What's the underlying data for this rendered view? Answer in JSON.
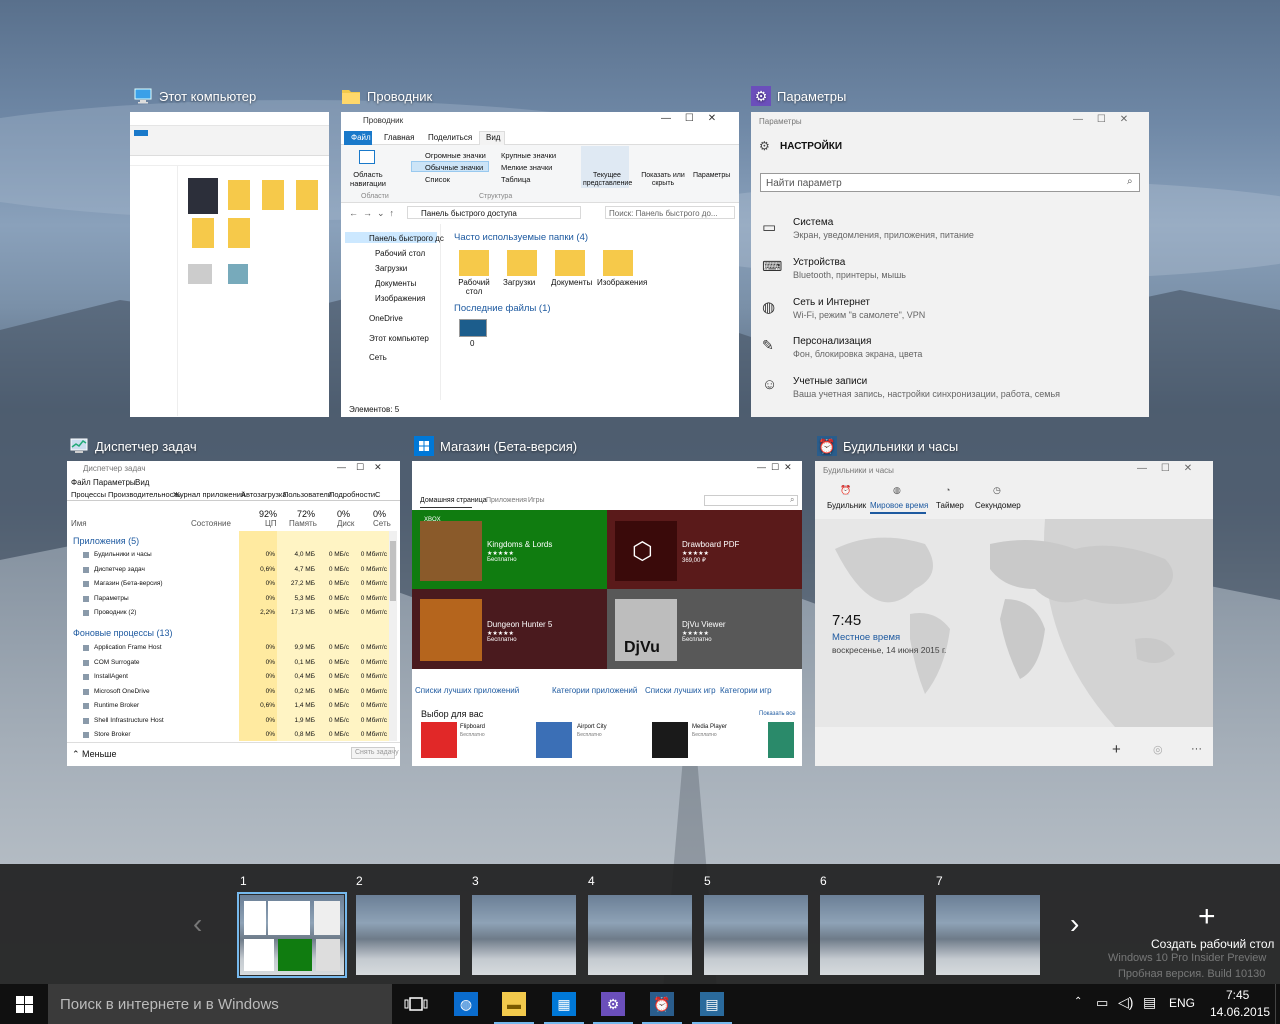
{
  "windows": {
    "this_pc": {
      "title": "Этот компьютер"
    },
    "explorer": {
      "title": "Проводник",
      "window_title": "Проводник",
      "ribbon_tabs": [
        "Файл",
        "Главная",
        "Поделиться",
        "Вид"
      ],
      "ribbon": {
        "nav_pane": "Область навигации",
        "huge": "Огромные значки",
        "large": "Крупные значки",
        "normal": "Обычные значки",
        "small": "Мелкие значки",
        "list": "Список",
        "table": "Таблица",
        "current_view": "Текущее представление",
        "show_hide": "Показать или скрыть",
        "params": "Параметры",
        "group_areas": "Области",
        "group_structure": "Структура"
      },
      "address": "Панель быстрого доступа",
      "search_placeholder": "Поиск: Панель быстрого до...",
      "nav": [
        "Панель быстрого дс",
        "Рабочий стол",
        "Загрузки",
        "Документы",
        "Изображения",
        "OneDrive",
        "Этот компьютер",
        "Сеть"
      ],
      "frequent_header": "Часто используемые папки (4)",
      "folders": [
        "Рабочий стол",
        "Загрузки",
        "Документы",
        "Изображения"
      ],
      "recent_header": "Последние файлы (1)",
      "recent_item": "0",
      "status": "Элементов: 5"
    },
    "settings": {
      "title": "Параметры",
      "window_title": "Параметры",
      "heading": "НАСТРОЙКИ",
      "search_placeholder": "Найти параметр",
      "items": [
        {
          "title": "Система",
          "desc": "Экран, уведомления, приложения, питание"
        },
        {
          "title": "Устройства",
          "desc": "Bluetooth, принтеры, мышь"
        },
        {
          "title": "Сеть и Интернет",
          "desc": "Wi-Fi, режим \"в самолете\", VPN"
        },
        {
          "title": "Персонализация",
          "desc": "Фон, блокировка экрана, цвета"
        },
        {
          "title": "Учетные записи",
          "desc": "Ваша учетная запись, настройки синхронизации, работа, семья"
        }
      ]
    },
    "task_manager": {
      "title": "Диспетчер задач",
      "window_title": "Диспетчер задач",
      "menu": [
        "Файл",
        "Параметры",
        "Вид"
      ],
      "tabs": [
        "Процессы",
        "Производительность",
        "Журнал приложений",
        "Автозагрузка",
        "Пользователи",
        "Подробности",
        "С"
      ],
      "columns": {
        "name": "Имя",
        "state": "Состояние",
        "cpu_pct": "92%",
        "cpu": "ЦП",
        "mem_pct": "72%",
        "mem": "Память",
        "disk_pct": "0%",
        "disk": "Диск",
        "net_pct": "0%",
        "net": "Сеть"
      },
      "apps_header": "Приложения (5)",
      "bg_header": "Фоновые процессы (13)",
      "apps": [
        {
          "name": "Будильники и часы",
          "cpu": "0%",
          "mem": "4,0 МБ",
          "disk": "0 МБ/с",
          "net": "0 Мбит/с"
        },
        {
          "name": "Диспетчер задач",
          "cpu": "0,6%",
          "mem": "4,7 МБ",
          "disk": "0 МБ/с",
          "net": "0 Мбит/с"
        },
        {
          "name": "Магазин (Бета-версия)",
          "cpu": "0%",
          "mem": "27,2 МБ",
          "disk": "0 МБ/с",
          "net": "0 Мбит/с"
        },
        {
          "name": "Параметры",
          "cpu": "0%",
          "mem": "5,3 МБ",
          "disk": "0 МБ/с",
          "net": "0 Мбит/с"
        },
        {
          "name": "Проводник (2)",
          "cpu": "2,2%",
          "mem": "17,3 МБ",
          "disk": "0 МБ/с",
          "net": "0 Мбит/с"
        }
      ],
      "bg": [
        {
          "name": "Application Frame Host",
          "cpu": "0%",
          "mem": "9,9 МБ",
          "disk": "0 МБ/с",
          "net": "0 Мбит/с"
        },
        {
          "name": "COM Surrogate",
          "cpu": "0%",
          "mem": "0,1 МБ",
          "disk": "0 МБ/с",
          "net": "0 Мбит/с"
        },
        {
          "name": "InstallAgent",
          "cpu": "0%",
          "mem": "0,4 МБ",
          "disk": "0 МБ/с",
          "net": "0 Мбит/с"
        },
        {
          "name": "Microsoft OneDrive",
          "cpu": "0%",
          "mem": "0,2 МБ",
          "disk": "0 МБ/с",
          "net": "0 Мбит/с"
        },
        {
          "name": "Runtime Broker",
          "cpu": "0,6%",
          "mem": "1,4 МБ",
          "disk": "0 МБ/с",
          "net": "0 Мбит/с"
        },
        {
          "name": "Shell Infrastructure Host",
          "cpu": "0%",
          "mem": "1,9 МБ",
          "disk": "0 МБ/с",
          "net": "0 Мбит/с"
        },
        {
          "name": "Store Broker",
          "cpu": "0%",
          "mem": "0,8 МБ",
          "disk": "0 МБ/с",
          "net": "0 Мбит/с"
        }
      ],
      "less": "Меньше",
      "end_task": "Снять задачу"
    },
    "store": {
      "title": "Магазин (Бета-версия)",
      "nav": [
        "Домашняя страница",
        "Приложения",
        "Игры"
      ],
      "tiles": [
        {
          "badge": "XBOX",
          "name": "Kingdoms & Lords",
          "price": "Бесплатно",
          "color": "#107c10"
        },
        {
          "name": "Drawboard PDF",
          "price": "369,00 ₽",
          "color": "#5a1a1a"
        },
        {
          "name": "Dungeon Hunter 5",
          "price": "Бесплатно",
          "color": "#4a1a1e"
        },
        {
          "name": "DjVu Viewer",
          "price": "Бесплатно",
          "color": "#585858"
        }
      ],
      "links": [
        "Списки лучших приложений",
        "Категории приложений",
        "Списки лучших игр",
        "Категории игр"
      ],
      "picks_header": "Выбор для вас",
      "show_all": "Показать все",
      "picks": [
        {
          "name": "Flipboard",
          "sub": "Бесплатно"
        },
        {
          "name": "Airport City",
          "sub": "Бесплатно"
        },
        {
          "name": "Media Player",
          "sub": "Бесплатно"
        }
      ]
    },
    "alarms": {
      "title": "Будильники и часы",
      "window_title": "Будильники и часы",
      "tabs": [
        "Будильник",
        "Мировое время",
        "Таймер",
        "Секундомер"
      ],
      "time": "7:45",
      "local": "Местное время",
      "date": "воскресенье, 14 июня 2015 г."
    }
  },
  "desktops": {
    "numbers": [
      "1",
      "2",
      "3",
      "4",
      "5",
      "6",
      "7"
    ],
    "create_label": "Создать рабочий стол"
  },
  "watermark": {
    "line1": "Windows 10 Pro Insider Preview",
    "line2": "Пробная версия. Build 10130"
  },
  "taskbar": {
    "search_placeholder": "Поиск в интернете и в Windows",
    "lang": "ENG",
    "time": "7:45",
    "date": "14.06.2015"
  },
  "colors": {
    "accent": "#6b4fbb",
    "store_green": "#107c10",
    "taskbar": "#101010"
  }
}
